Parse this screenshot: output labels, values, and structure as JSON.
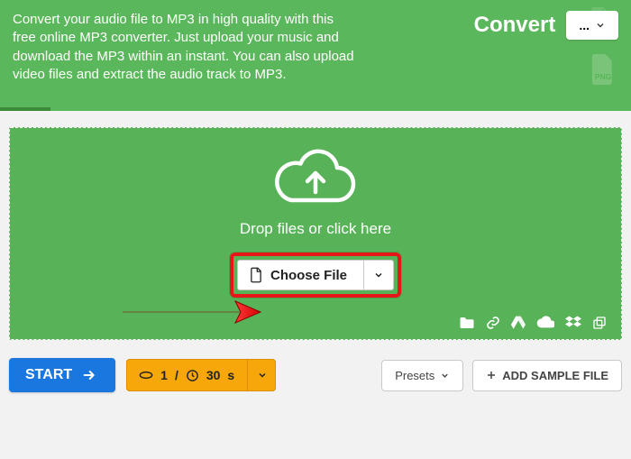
{
  "header": {
    "description": "Convert your audio file to MP3 in high quality with this free online MP3 converter. Just upload your music and download the MP3 within an instant. You can also upload video files and extract the audio track to MP3.",
    "convert_label": "Convert",
    "target_format": "...",
    "badge_png": "PNG"
  },
  "dropzone": {
    "hint": "Drop files or click here",
    "choose_label": "Choose File"
  },
  "bottom": {
    "start_label": "START",
    "trim_count": "1",
    "trim_sep": "/",
    "trim_time_value": "30",
    "trim_time_unit": "s",
    "presets_label": "Presets",
    "add_sample_label": "ADD SAMPLE FILE"
  }
}
